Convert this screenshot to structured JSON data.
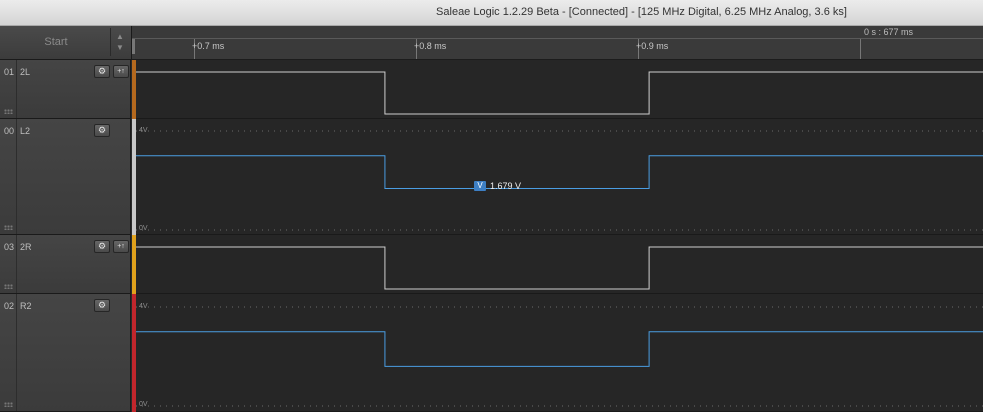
{
  "window": {
    "title": "Saleae Logic 1.2.29 Beta - [Connected] - [125 MHz Digital, 6.25 MHz Analog, 3.6 ks]"
  },
  "toolbar": {
    "start_label": "Start",
    "arrow_up": "▲",
    "arrow_down": "▼"
  },
  "ruler": {
    "ticks": [
      "+0.7 ms",
      "+0.8 ms",
      "+0.9 ms"
    ],
    "readout": "0 s : 677 ms"
  },
  "icons": {
    "settings": "gear-icon",
    "trigger": "trigger-edge-icon",
    "settings_glyph": "⚙",
    "trigger_glyph": "+↑"
  },
  "channels": [
    {
      "number": "01",
      "name": "2L",
      "type": "digital",
      "strip_color": "#b5691e",
      "trace_color": "#cfcfcf",
      "low_start_ms": 0.786,
      "low_end_ms": 0.905
    },
    {
      "number": "00",
      "name": "L2",
      "type": "analog",
      "strip_color": "#c8c8c8",
      "trace_color": "#4a9de2",
      "axis_top": "4V",
      "axis_bottom": "0V",
      "high_volts": 3.0,
      "low_volts": 1.679,
      "low_start_ms": 0.786,
      "low_end_ms": 0.905,
      "measurement": {
        "badge": "V",
        "value": "1.679 V"
      }
    },
    {
      "number": "03",
      "name": "2R",
      "type": "digital",
      "strip_color": "#e1a21c",
      "trace_color": "#cfcfcf",
      "low_start_ms": 0.786,
      "low_end_ms": 0.905
    },
    {
      "number": "02",
      "name": "R2",
      "type": "analog",
      "strip_color": "#c2262c",
      "trace_color": "#4a9de2",
      "axis_top": "4V",
      "axis_bottom": "0V",
      "high_volts": 3.0,
      "low_volts": 1.6,
      "low_start_ms": 0.786,
      "low_end_ms": 0.905
    }
  ],
  "colors": {
    "background": "#2b2b2b",
    "plot_background": "#262626",
    "analog_trace": "#4a9de2",
    "digital_trace": "#cfcfcf",
    "measure_badge": "#3d7fc4"
  }
}
